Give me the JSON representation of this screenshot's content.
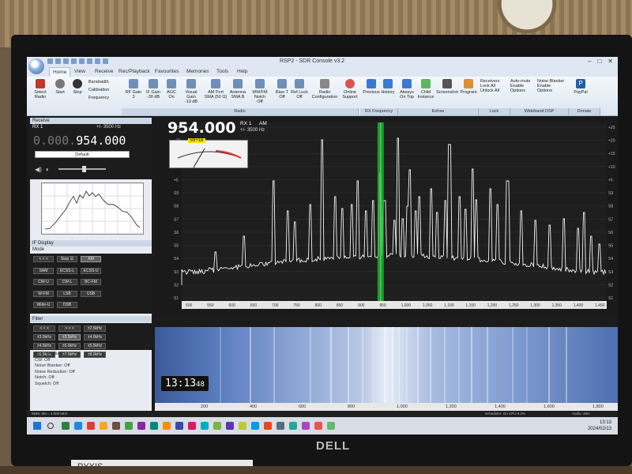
{
  "window": {
    "title": "RSP2 - SDR Console v3.2"
  },
  "menu_tabs": [
    "Home",
    "View",
    "Receive",
    "Rec/Playback",
    "Favourites",
    "Memories",
    "Tools",
    "Help"
  ],
  "ribbon": {
    "buttons": [
      {
        "label": "Select Radio",
        "x": 6
      },
      {
        "label": "Start",
        "x": 32
      },
      {
        "label": "Stop",
        "x": 54
      }
    ],
    "side_items": [
      "Bandwidth",
      "Calibration",
      "Frequency"
    ],
    "controls": [
      {
        "label": "RF Gain",
        "sub": "3"
      },
      {
        "label": "IF Gain",
        "sub": "-30 dB"
      },
      {
        "label": "AGC",
        "sub": "On"
      },
      {
        "label": "Visual Gain",
        "sub": "-10 dB"
      },
      {
        "label": "AM Port",
        "sub": "SMA (50 Ω)"
      },
      {
        "label": "Antenna",
        "sub": "SMA B"
      },
      {
        "label": "MW/FM Notch",
        "sub": "Off"
      },
      {
        "label": "Bias-T",
        "sub": "Off"
      },
      {
        "label": "Ref Lock",
        "sub": "Off"
      },
      {
        "label": "Radio Configuration",
        "sub": ""
      },
      {
        "label": "Online Support",
        "sub": ""
      },
      {
        "label": "Previous",
        "sub": ""
      },
      {
        "label": "History",
        "sub": ""
      },
      {
        "label": "Always On Top",
        "sub": ""
      },
      {
        "label": "Child Instance",
        "sub": ""
      },
      {
        "label": "Screenshot",
        "sub": ""
      },
      {
        "label": "Program",
        "sub": ""
      }
    ],
    "receivers": [
      "Receivers",
      "Lock All",
      "Unlock All"
    ],
    "automute": [
      "Auto-mute",
      "Enable",
      "Options"
    ],
    "noiseblanker": [
      "Noise Blanker",
      "Enable",
      "Options"
    ],
    "paypal": "PayPal",
    "groups": [
      "Radio",
      "RX Frequency",
      "Extras",
      "Lock",
      "Wideband DSP",
      "Donate"
    ]
  },
  "receive_panel": {
    "header": "Receive",
    "rx": "RX 1",
    "bandwidth": "+/- 3500 Hz",
    "freq_dim": "0.000.",
    "freq_main": "954.000",
    "preset": "Default"
  },
  "if_display": {
    "header": "IF Display",
    "mode_header": "Mode"
  },
  "modes": [
    "< < <",
    "Step ☰",
    "AM",
    "SAM",
    "ECSS-L",
    "ECSS-U",
    "CW-U",
    "CW-L",
    "BC-FM",
    "W-FM",
    "LSB",
    "USB",
    "Wide-U",
    "DSB"
  ],
  "filter": {
    "header": "Filter",
    "buttons": [
      "< < <",
      "> > >",
      "±2.5kHz",
      "±3.0kHz",
      "±3.5kHz",
      "±4.0kHz",
      "±4.5kHz",
      "±5.0kHz",
      "±5.5kHz",
      "±6.0kHz",
      "±7.0kHz",
      "±8.0kHz"
    ]
  },
  "agc_list": [
    "AGC: Medium",
    "CW: Off",
    "Noise Blanker: Off",
    "Noise Reduction: Off",
    "Notch: Off",
    "Squelch: Off"
  ],
  "spectrum": {
    "frequency": "954.000",
    "rx": "RX 1",
    "mode": "AM",
    "bandwidth": "+/- 3500 Hz",
    "smeter": "S9+16",
    "x_ticks": [
      "500",
      "550",
      "600",
      "650",
      "700",
      "750",
      "800",
      "850",
      "900",
      "950",
      "1,000",
      "1,050",
      "1,100",
      "1,150",
      "1,200",
      "1,250",
      "1,300",
      "1,350",
      "1,400",
      "1,450"
    ],
    "y_ticks_left": [
      "+25",
      "+20",
      "+15",
      "+10",
      "+5",
      "S9",
      "S8",
      "S7",
      "S6",
      "S5",
      "S4",
      "S3",
      "S2",
      "S1"
    ],
    "y_ticks_right": [
      "+25",
      "+20",
      "+15",
      "+10",
      "+5",
      "S9",
      "S8",
      "S7",
      "S6",
      "S5",
      "S4",
      "S3",
      "S2",
      "S1"
    ]
  },
  "waterfall": {
    "clock_hm": "13:13",
    "clock_s": "48",
    "axis": [
      "200",
      "400",
      "600",
      "800",
      "1,000",
      "1,200",
      "1,400",
      "1,600",
      "1,800"
    ]
  },
  "statusbar": {
    "left": "8585, 8M = 1.000 MHz",
    "mid": "Scheduler: On   CPU 9.2%",
    "right": "Audio: 48m"
  },
  "taskbar": {
    "time": "13:13",
    "date": "2024/02/13"
  },
  "brand": "DELL",
  "label": "PYXIS"
}
